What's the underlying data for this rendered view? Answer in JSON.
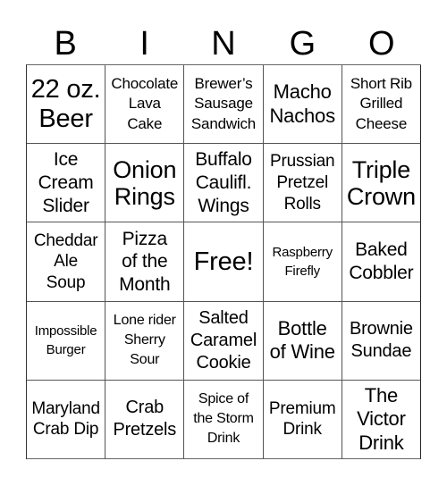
{
  "header": {
    "letters": [
      "B",
      "I",
      "N",
      "G",
      "O"
    ]
  },
  "board": {
    "rows": [
      [
        "22 oz.\nBeer",
        "Chocolate\nLava\nCake",
        "Brewer’s\nSausage\nSandwich",
        "Macho\nNachos",
        "Short Rib\nGrilled\nCheese"
      ],
      [
        "Ice\nCream\nSlider",
        "Onion\nRings",
        "Buffalo\nCaulifl.\nWings",
        "Prussian\nPretzel\nRolls",
        "Triple\nCrown"
      ],
      [
        "Cheddar\nAle\nSoup",
        "Pizza\nof the\nMonth",
        "Free!",
        "Raspberry\nFirefly",
        "Baked\nCobbler"
      ],
      [
        "Impossible\nBurger",
        "Lone rider\nSherry\nSour",
        "Salted\nCaramel\nCookie",
        "Bottle\nof Wine",
        "Brownie\nSundae"
      ],
      [
        "Maryland\nCrab Dip",
        "Crab\nPretzels",
        "Spice of\nthe Storm\nDrink",
        "Premium\nDrink",
        "The\nVictor\nDrink"
      ]
    ]
  },
  "colors": {
    "grid_line": "#555555",
    "text": "#000000",
    "background": "#ffffff"
  }
}
